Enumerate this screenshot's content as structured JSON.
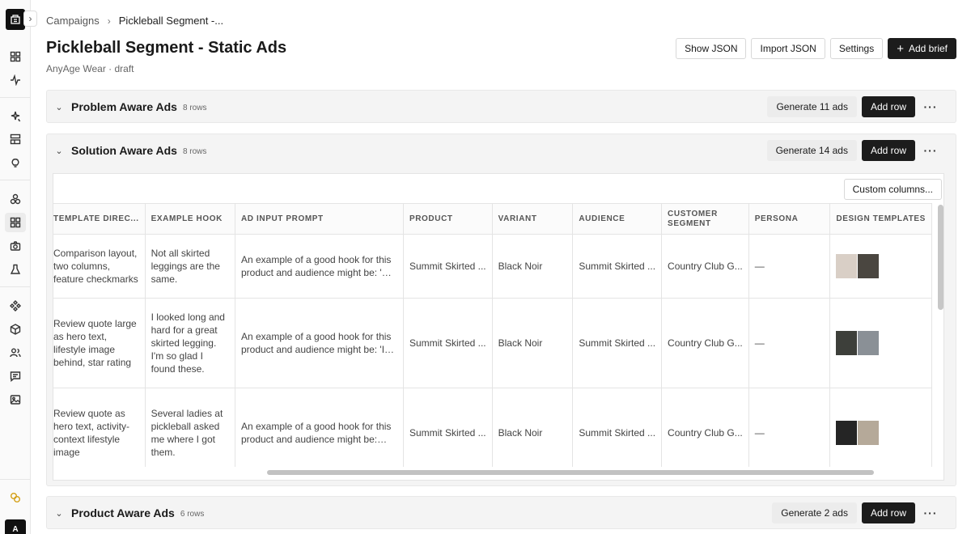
{
  "breadcrumb": {
    "root": "Campaigns",
    "current": "Pickleball Segment -..."
  },
  "page": {
    "title": "Pickleball Segment - Static Ads",
    "subtitle": "AnyAge Wear · draft"
  },
  "header_buttons": {
    "show_json": "Show JSON",
    "import_json": "Import JSON",
    "settings": "Settings",
    "add_brief": "Add brief"
  },
  "user": {
    "avatar": "A"
  },
  "sections": [
    {
      "name": "Problem Aware Ads",
      "rows": "8 rows",
      "generate": "Generate 11 ads",
      "add_row": "Add row"
    },
    {
      "name": "Solution Aware Ads",
      "rows": "8 rows",
      "generate": "Generate 14 ads",
      "add_row": "Add row"
    },
    {
      "name": "Product Aware Ads",
      "rows": "6 rows",
      "generate": "Generate 2 ads",
      "add_row": "Add row"
    }
  ],
  "table": {
    "custom_columns": "Custom columns...",
    "columns": [
      "TEMPLATE DIREC...",
      "EXAMPLE HOOK",
      "AD INPUT PROMPT",
      "PRODUCT",
      "VARIANT",
      "AUDIENCE",
      "CUSTOMER SEGMENT",
      "PERSONA",
      "DESIGN TEMPLATES"
    ],
    "rows": [
      {
        "template": "Comparison layout, two columns, feature checkmarks",
        "hook": "Not all skirted leggings are the same.",
        "prompt": "An example of a good hook for this product and audience might be: 'Not all skirted leggings are the same.'",
        "product": "Summit Skirted ...",
        "variant": "Black Noir",
        "audience": "Summit Skirted ...",
        "segment": "Country Club G...",
        "persona": "—",
        "thumbs": [
          "#d9cfc6",
          "#4a4640"
        ]
      },
      {
        "template": "Review quote large as hero text, lifestyle image behind, star rating",
        "hook": "I looked long and hard for a great skirted legging. I'm so glad I found these.",
        "prompt": "An example of a good hook for this product and audience might be: 'I looked long and hard...'",
        "product": "Summit Skirted ...",
        "variant": "Black Noir",
        "audience": "Summit Skirted ...",
        "segment": "Country Club G...",
        "persona": "—",
        "thumbs": [
          "#3d3f3a",
          "#8a9096"
        ]
      },
      {
        "template": "Review quote as hero text, activity-context lifestyle image",
        "hook": "Several ladies at pickleball asked me where I got them.",
        "prompt": "An example of a good hook for this product and audience might be: 'Several ladies...'",
        "product": "Summit Skirted ...",
        "variant": "Black Noir",
        "audience": "Summit Skirted ...",
        "segment": "Country Club G...",
        "persona": "—",
        "thumbs": [
          "#252525",
          "#b5a999"
        ]
      }
    ]
  }
}
